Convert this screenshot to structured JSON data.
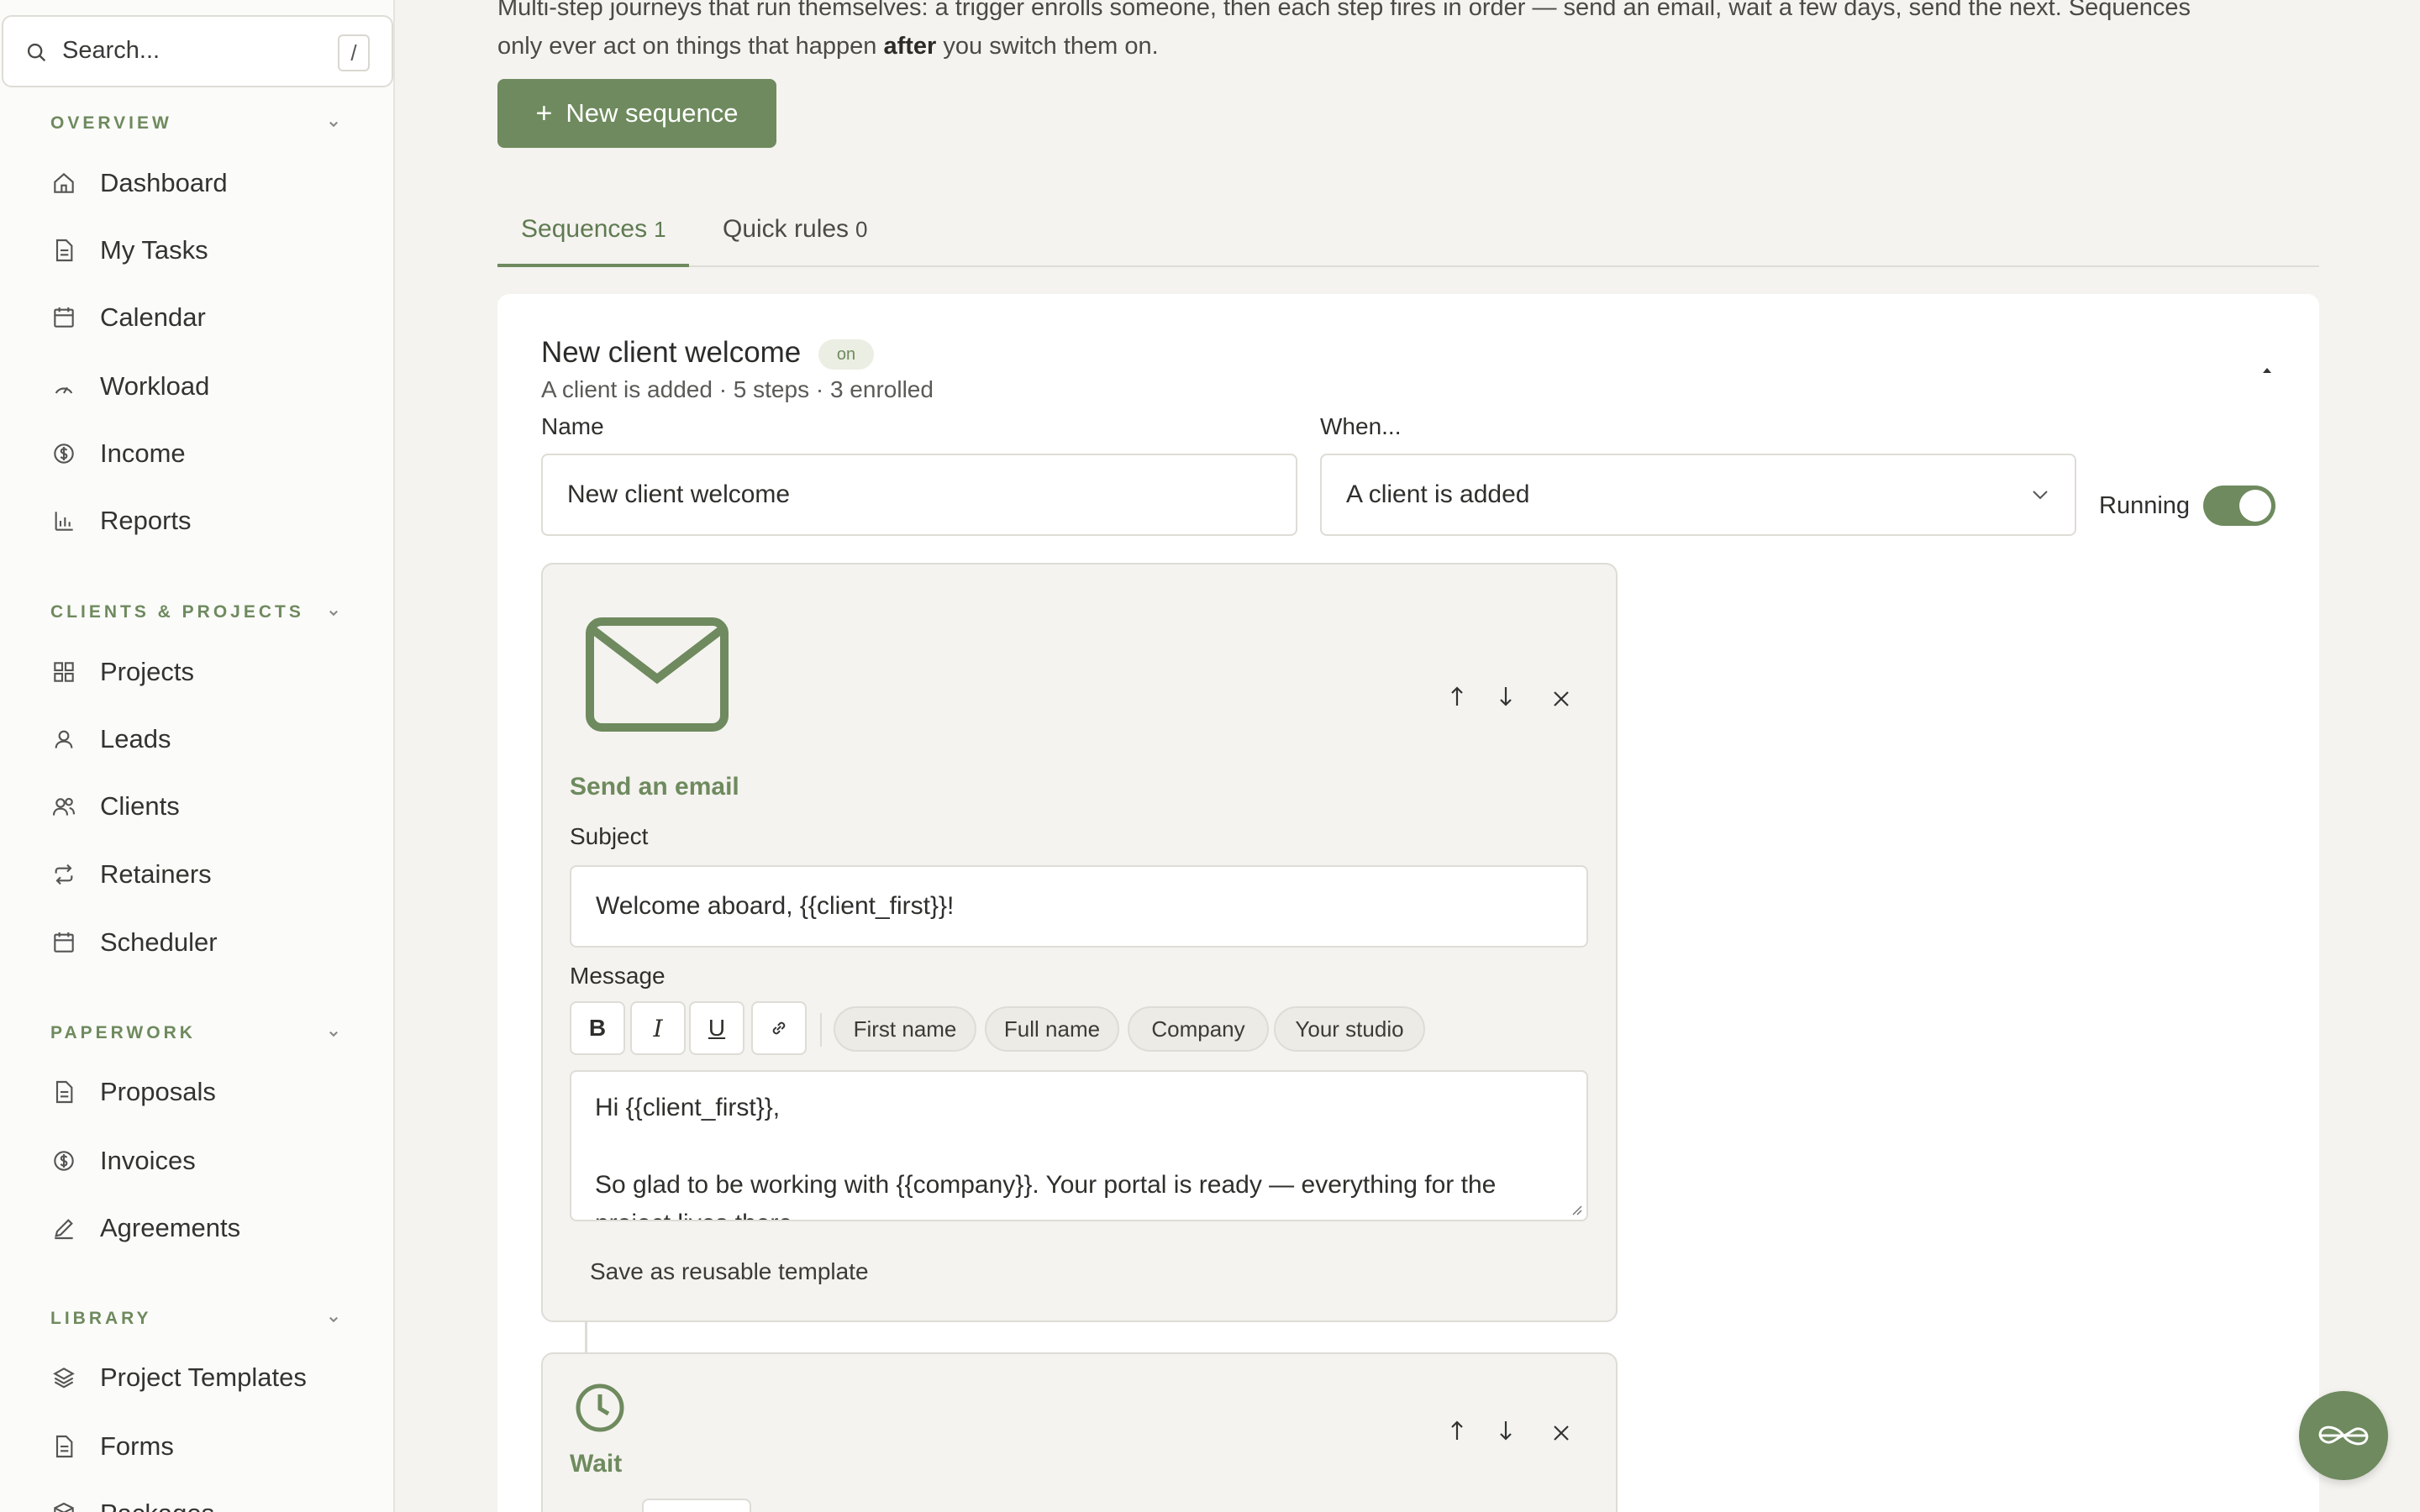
{
  "sidebar": {
    "search": {
      "placeholder": "Search...",
      "shortcut": "/"
    },
    "sections": [
      {
        "label": "OVERVIEW",
        "items": [
          {
            "label": "Dashboard",
            "icon": "home-icon"
          },
          {
            "label": "My Tasks",
            "icon": "file-icon"
          },
          {
            "label": "Calendar",
            "icon": "calendar-icon"
          },
          {
            "label": "Workload",
            "icon": "gauge-icon"
          },
          {
            "label": "Income",
            "icon": "dollar-circle-icon"
          },
          {
            "label": "Reports",
            "icon": "bar-chart-icon"
          }
        ]
      },
      {
        "label": "CLIENTS & PROJECTS",
        "items": [
          {
            "label": "Projects",
            "icon": "grid-icon"
          },
          {
            "label": "Leads",
            "icon": "user-icon"
          },
          {
            "label": "Clients",
            "icon": "users-icon"
          },
          {
            "label": "Retainers",
            "icon": "repeat-icon"
          },
          {
            "label": "Scheduler",
            "icon": "calendar-icon"
          }
        ]
      },
      {
        "label": "PAPERWORK",
        "items": [
          {
            "label": "Proposals",
            "icon": "file-icon"
          },
          {
            "label": "Invoices",
            "icon": "dollar-circle-icon"
          },
          {
            "label": "Agreements",
            "icon": "pen-icon"
          }
        ]
      },
      {
        "label": "LIBRARY",
        "items": [
          {
            "label": "Project Templates",
            "icon": "layers-icon"
          },
          {
            "label": "Forms",
            "icon": "file-icon"
          },
          {
            "label": "Packages",
            "icon": "package-icon"
          }
        ]
      }
    ]
  },
  "main": {
    "intro_line1": "Multi-step journeys that run themselves: a trigger enrolls someone, then each step fires in order — send an email, wait a few days, send the next. Sequences",
    "intro_line2_before": "only ever act on things that happen ",
    "intro_line2_bold": "after",
    "intro_line2_after": " you switch them on.",
    "new_button": "New sequence",
    "tabs": [
      {
        "label": "Sequences",
        "count": "1",
        "active": true
      },
      {
        "label": "Quick rules",
        "count": "0",
        "active": false
      }
    ],
    "sequence": {
      "title": "New client welcome",
      "status_badge": "on",
      "summary": "A client is added · 5 steps · 3 enrolled",
      "name_label": "Name",
      "name_value": "New client welcome",
      "when_label": "When...",
      "when_value": "A client is added",
      "running_label": "Running",
      "running": true,
      "steps": [
        {
          "type": "Send an email",
          "icon": "mail-icon",
          "subject_label": "Subject",
          "subject_value": "Welcome aboard, {{client_first}}!",
          "message_label": "Message",
          "toolbar": [
            "B",
            "I",
            "U"
          ],
          "merge_chips": [
            "First name",
            "Full name",
            "Company",
            "Your studio"
          ],
          "message_lines": [
            "Hi {{client_first}},",
            "",
            "So glad to be working with {{company}}. Your portal is ready — everything for the",
            "project lives there."
          ],
          "save_template": "Save as reusable template"
        },
        {
          "type": "Wait",
          "icon": "clock-icon"
        }
      ]
    }
  },
  "colors": {
    "accent": "#6e8a5e",
    "background": "#f4f3ef",
    "sidebar": "#fbfbf9"
  }
}
